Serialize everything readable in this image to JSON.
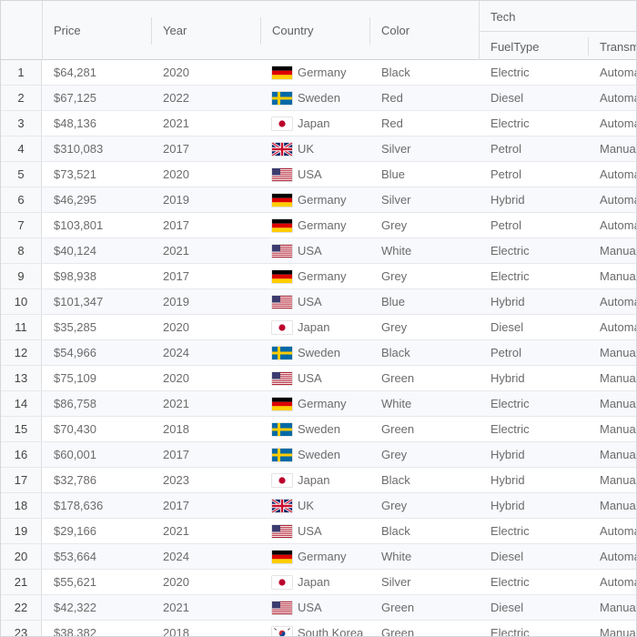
{
  "columns": {
    "price": "Price",
    "year": "Year",
    "country": "Country",
    "color": "Color",
    "tech_group": "Tech",
    "fuel": "FuelType",
    "transmission": "Transmission"
  },
  "rows": [
    {
      "n": "1",
      "price": "$64,281",
      "year": "2020",
      "country": "Germany",
      "flag": "germany-flag",
      "color": "Black",
      "fuel": "Electric",
      "trans": "Automatic"
    },
    {
      "n": "2",
      "price": "$67,125",
      "year": "2022",
      "country": "Sweden",
      "flag": "sweden-flag",
      "color": "Red",
      "fuel": "Diesel",
      "trans": "Automatic"
    },
    {
      "n": "3",
      "price": "$48,136",
      "year": "2021",
      "country": "Japan",
      "flag": "japan-flag",
      "color": "Red",
      "fuel": "Electric",
      "trans": "Automatic"
    },
    {
      "n": "4",
      "price": "$310,083",
      "year": "2017",
      "country": "UK",
      "flag": "uk-flag",
      "color": "Silver",
      "fuel": "Petrol",
      "trans": "Manual"
    },
    {
      "n": "5",
      "price": "$73,521",
      "year": "2020",
      "country": "USA",
      "flag": "usa-flag",
      "color": "Blue",
      "fuel": "Petrol",
      "trans": "Automatic"
    },
    {
      "n": "6",
      "price": "$46,295",
      "year": "2019",
      "country": "Germany",
      "flag": "germany-flag",
      "color": "Silver",
      "fuel": "Hybrid",
      "trans": "Automatic"
    },
    {
      "n": "7",
      "price": "$103,801",
      "year": "2017",
      "country": "Germany",
      "flag": "germany-flag",
      "color": "Grey",
      "fuel": "Petrol",
      "trans": "Automatic"
    },
    {
      "n": "8",
      "price": "$40,124",
      "year": "2021",
      "country": "USA",
      "flag": "usa-flag",
      "color": "White",
      "fuel": "Electric",
      "trans": "Manual"
    },
    {
      "n": "9",
      "price": "$98,938",
      "year": "2017",
      "country": "Germany",
      "flag": "germany-flag",
      "color": "Grey",
      "fuel": "Electric",
      "trans": "Manual"
    },
    {
      "n": "10",
      "price": "$101,347",
      "year": "2019",
      "country": "USA",
      "flag": "usa-flag",
      "color": "Blue",
      "fuel": "Hybrid",
      "trans": "Automatic"
    },
    {
      "n": "11",
      "price": "$35,285",
      "year": "2020",
      "country": "Japan",
      "flag": "japan-flag",
      "color": "Grey",
      "fuel": "Diesel",
      "trans": "Automatic"
    },
    {
      "n": "12",
      "price": "$54,966",
      "year": "2024",
      "country": "Sweden",
      "flag": "sweden-flag",
      "color": "Black",
      "fuel": "Petrol",
      "trans": "Manual"
    },
    {
      "n": "13",
      "price": "$75,109",
      "year": "2020",
      "country": "USA",
      "flag": "usa-flag",
      "color": "Green",
      "fuel": "Hybrid",
      "trans": "Manual"
    },
    {
      "n": "14",
      "price": "$86,758",
      "year": "2021",
      "country": "Germany",
      "flag": "germany-flag",
      "color": "White",
      "fuel": "Electric",
      "trans": "Manual"
    },
    {
      "n": "15",
      "price": "$70,430",
      "year": "2018",
      "country": "Sweden",
      "flag": "sweden-flag",
      "color": "Green",
      "fuel": "Electric",
      "trans": "Manual"
    },
    {
      "n": "16",
      "price": "$60,001",
      "year": "2017",
      "country": "Sweden",
      "flag": "sweden-flag",
      "color": "Grey",
      "fuel": "Hybrid",
      "trans": "Manual"
    },
    {
      "n": "17",
      "price": "$32,786",
      "year": "2023",
      "country": "Japan",
      "flag": "japan-flag",
      "color": "Black",
      "fuel": "Hybrid",
      "trans": "Manual"
    },
    {
      "n": "18",
      "price": "$178,636",
      "year": "2017",
      "country": "UK",
      "flag": "uk-flag",
      "color": "Grey",
      "fuel": "Hybrid",
      "trans": "Manual"
    },
    {
      "n": "19",
      "price": "$29,166",
      "year": "2021",
      "country": "USA",
      "flag": "usa-flag",
      "color": "Black",
      "fuel": "Electric",
      "trans": "Automatic"
    },
    {
      "n": "20",
      "price": "$53,664",
      "year": "2024",
      "country": "Germany",
      "flag": "germany-flag",
      "color": "White",
      "fuel": "Diesel",
      "trans": "Automatic"
    },
    {
      "n": "21",
      "price": "$55,621",
      "year": "2020",
      "country": "Japan",
      "flag": "japan-flag",
      "color": "Silver",
      "fuel": "Electric",
      "trans": "Automatic"
    },
    {
      "n": "22",
      "price": "$42,322",
      "year": "2021",
      "country": "USA",
      "flag": "usa-flag",
      "color": "Green",
      "fuel": "Diesel",
      "trans": "Manual"
    },
    {
      "n": "23",
      "price": "$38,382",
      "year": "2018",
      "country": "South Korea",
      "flag": "south-korea-flag",
      "color": "Green",
      "fuel": "Electric",
      "trans": "Manual"
    }
  ]
}
